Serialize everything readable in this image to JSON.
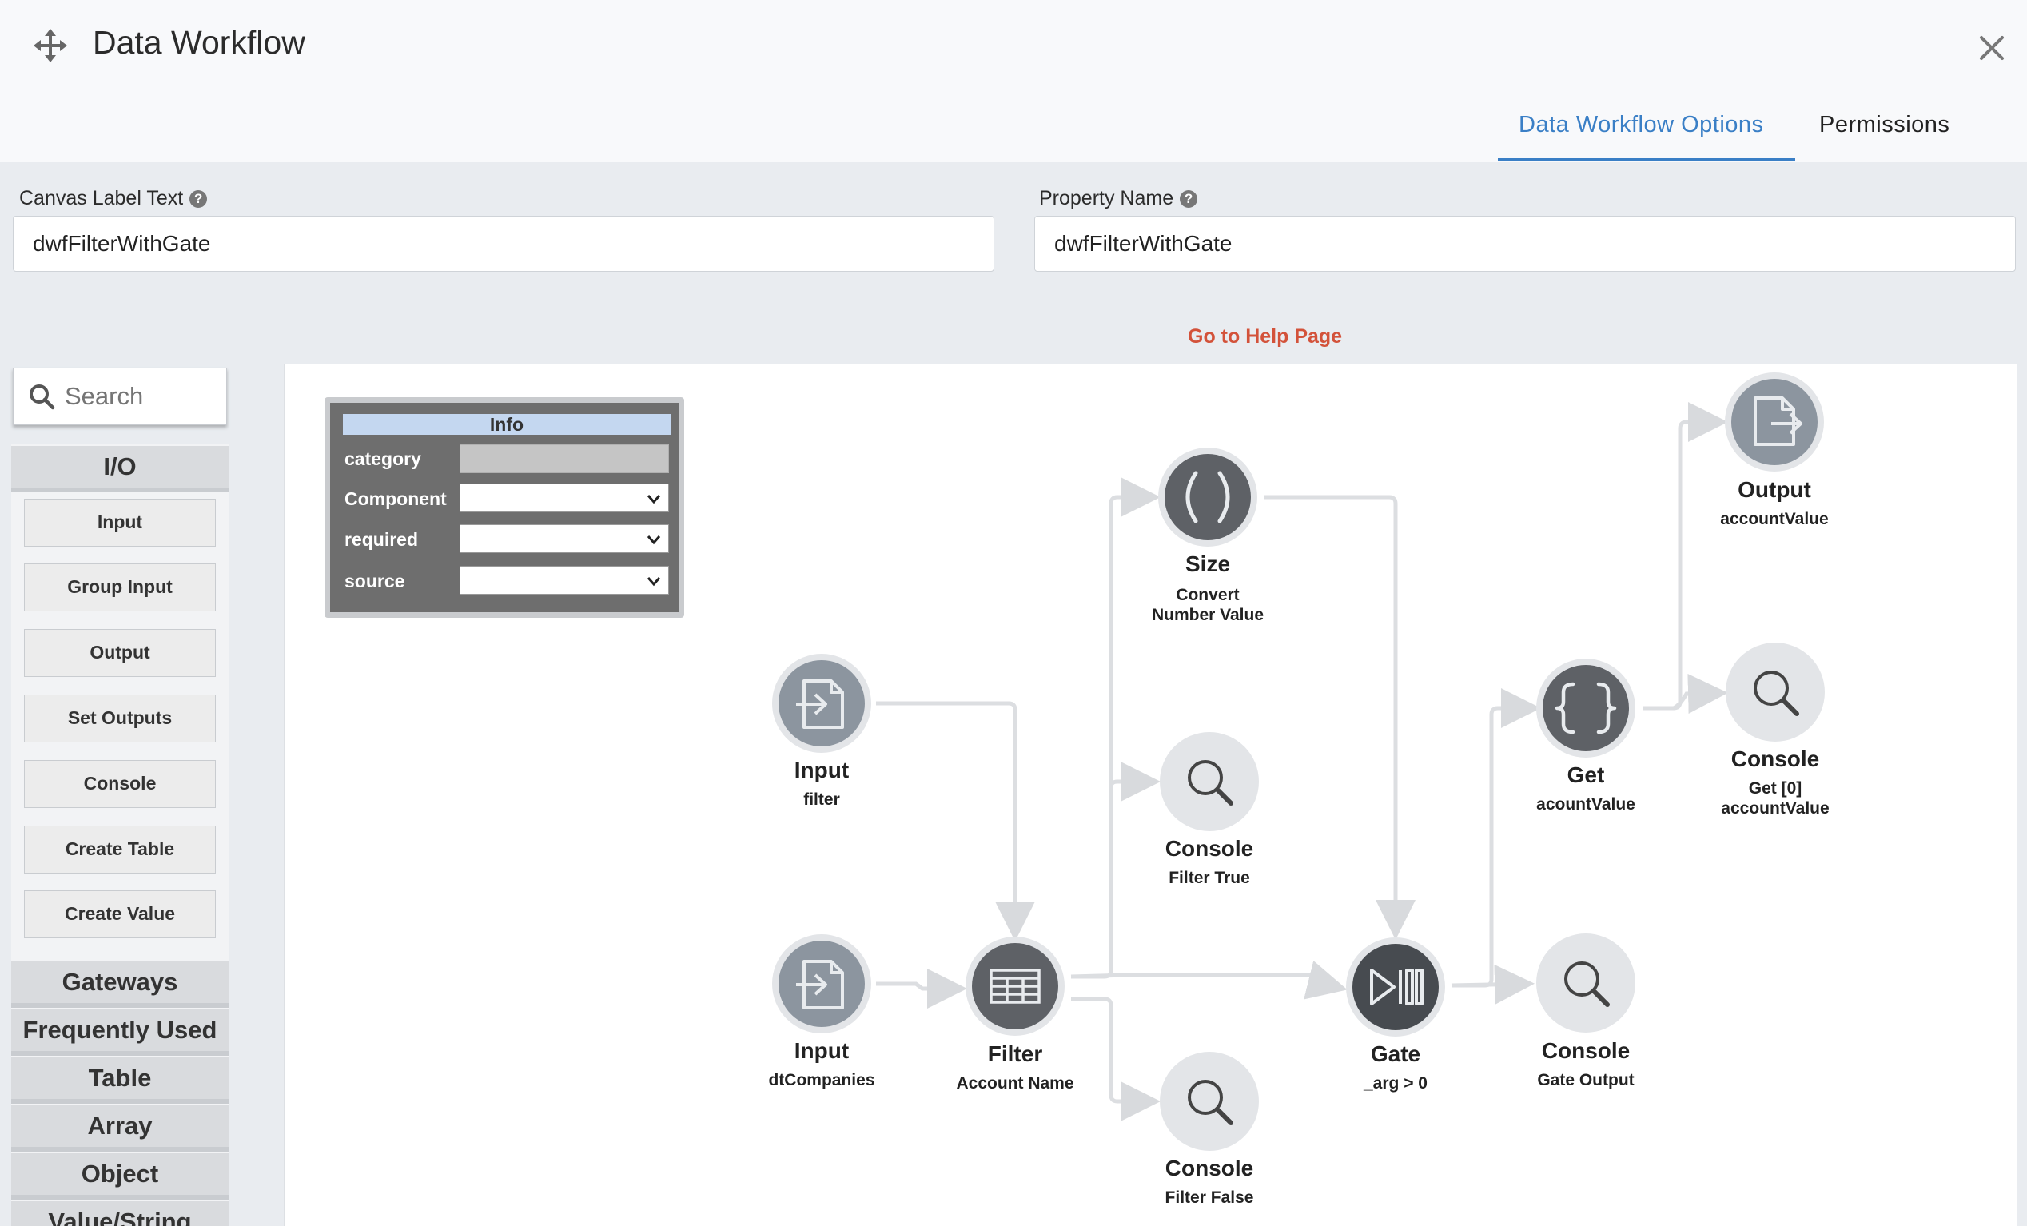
{
  "header": {
    "title": "Data Workflow",
    "tabs": [
      {
        "label": "Data Workflow Options",
        "active": true
      },
      {
        "label": "Permissions",
        "active": false
      }
    ]
  },
  "form": {
    "canvas_label": {
      "label": "Canvas Label Text",
      "value": "dwfFilterWithGate"
    },
    "property_name": {
      "label": "Property Name",
      "value": "dwfFilterWithGate"
    },
    "help_link": "Go to Help Page",
    "help_glyph": "?"
  },
  "sidebar": {
    "search_placeholder": "Search",
    "groups": {
      "io": "I/O",
      "gateways": "Gateways",
      "frequently_used": "Frequently Used",
      "table": "Table",
      "array": "Array",
      "object": "Object",
      "value_string": "Value/String"
    },
    "io_items": [
      "Input",
      "Group Input",
      "Output",
      "Set Outputs",
      "Console",
      "Create Table",
      "Create Value"
    ]
  },
  "info_panel": {
    "title": "Info",
    "rows": [
      {
        "key": "category",
        "value": ""
      },
      {
        "key": "Component",
        "value": ""
      },
      {
        "key": "required",
        "value": ""
      },
      {
        "key": "source",
        "value": ""
      }
    ]
  },
  "nodes": {
    "input_filter": {
      "type": "Input",
      "sub1": "filter",
      "sub2": "",
      "icon": "file-import-icon"
    },
    "input_dtcompanies": {
      "type": "Input",
      "sub1": "dtCompanies",
      "sub2": "",
      "icon": "file-import-icon"
    },
    "filter": {
      "type": "Filter",
      "sub1": "Account Name",
      "sub2": "",
      "icon": "table-icon"
    },
    "size": {
      "type": "Size",
      "sub1": "Convert",
      "sub2": "Number Value",
      "icon": "parentheses-icon"
    },
    "console_filter_true": {
      "type": "Console",
      "sub1": "Filter True",
      "sub2": "",
      "icon": "magnifier-icon"
    },
    "console_filter_false": {
      "type": "Console",
      "sub1": "Filter False",
      "sub2": "",
      "icon": "magnifier-icon"
    },
    "gate": {
      "type": "Gate",
      "sub1": "_arg > 0",
      "sub2": "",
      "icon": "play-pause-icon"
    },
    "get": {
      "type": "Get",
      "sub1": "acountValue",
      "sub2": "",
      "icon": "braces-icon"
    },
    "console_gate_output": {
      "type": "Console",
      "sub1": "Gate Output",
      "sub2": "",
      "icon": "magnifier-icon"
    },
    "output": {
      "type": "Output",
      "sub1": "accountValue",
      "sub2": "",
      "icon": "file-export-icon"
    },
    "console_get": {
      "type": "Console",
      "sub1": "Get [0]",
      "sub2": "accountValue",
      "icon": "magnifier-icon"
    }
  },
  "colors": {
    "accent": "#3a7fc6",
    "help_link": "#d3523a",
    "node_light": "#e3e5e8",
    "node_gray": "#8c959f",
    "node_dark": "#5e6166",
    "node_darker": "#474b50"
  }
}
